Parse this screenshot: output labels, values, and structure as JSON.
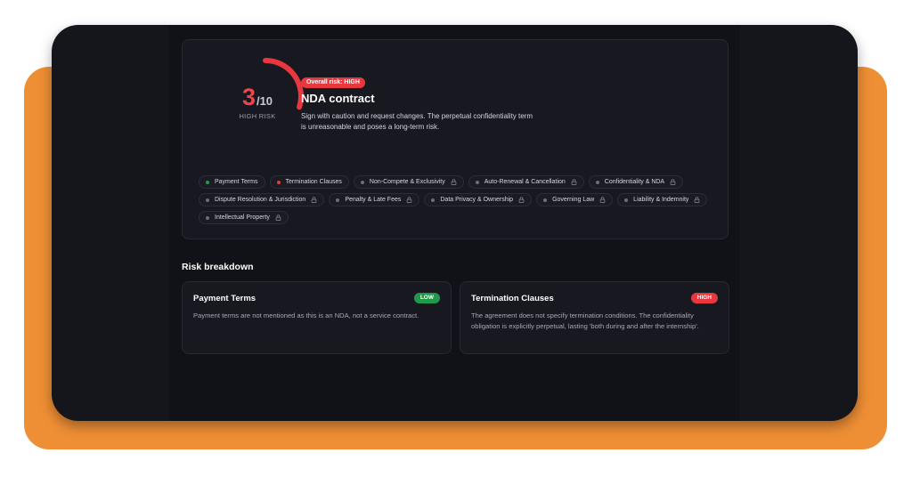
{
  "summary": {
    "score": "3",
    "score_max": "/10",
    "score_fraction": 0.3,
    "risk_label": "HIGH RISK",
    "overall_badge": "Overall risk: HIGH",
    "title": "NDA contract",
    "description": "Sign with caution and request changes. The perpetual confidentiality term is unreasonable and poses a long-term risk."
  },
  "colors": {
    "accent_red": "#e8383f",
    "accent_green": "#1e9a4a",
    "muted_dot": "#6a6e7c",
    "orange_backdrop": "#ef8f35"
  },
  "chips": [
    {
      "label": "Payment Terms",
      "status": "green",
      "locked": false
    },
    {
      "label": "Termination Clauses",
      "status": "red",
      "locked": false
    },
    {
      "label": "Non-Compete & Exclusivity",
      "status": "muted",
      "locked": true
    },
    {
      "label": "Auto-Renewal & Cancellation",
      "status": "muted",
      "locked": true
    },
    {
      "label": "Confidentiality & NDA",
      "status": "muted",
      "locked": true
    },
    {
      "label": "Dispute Resolution & Jurisdiction",
      "status": "muted",
      "locked": true
    },
    {
      "label": "Penalty & Late Fees",
      "status": "muted",
      "locked": true
    },
    {
      "label": "Data Privacy & Ownership",
      "status": "muted",
      "locked": true
    },
    {
      "label": "Governing Law",
      "status": "muted",
      "locked": true
    },
    {
      "label": "Liability & Indemnity",
      "status": "muted",
      "locked": true
    },
    {
      "label": "Intellectual Property",
      "status": "muted",
      "locked": true
    }
  ],
  "breakdown": {
    "title": "Risk breakdown",
    "cards": [
      {
        "title": "Payment Terms",
        "badge": "LOW",
        "level": "low",
        "text": "Payment terms are not mentioned as this is an NDA, not a service contract."
      },
      {
        "title": "Termination Clauses",
        "badge": "HIGH",
        "level": "high",
        "text": "The agreement does not specify termination conditions. The confidentiality obligation is explicitly perpetual, lasting 'both during and after the internship'."
      }
    ]
  },
  "icons": {
    "lock": "lock-icon",
    "gauge": "risk-gauge"
  }
}
